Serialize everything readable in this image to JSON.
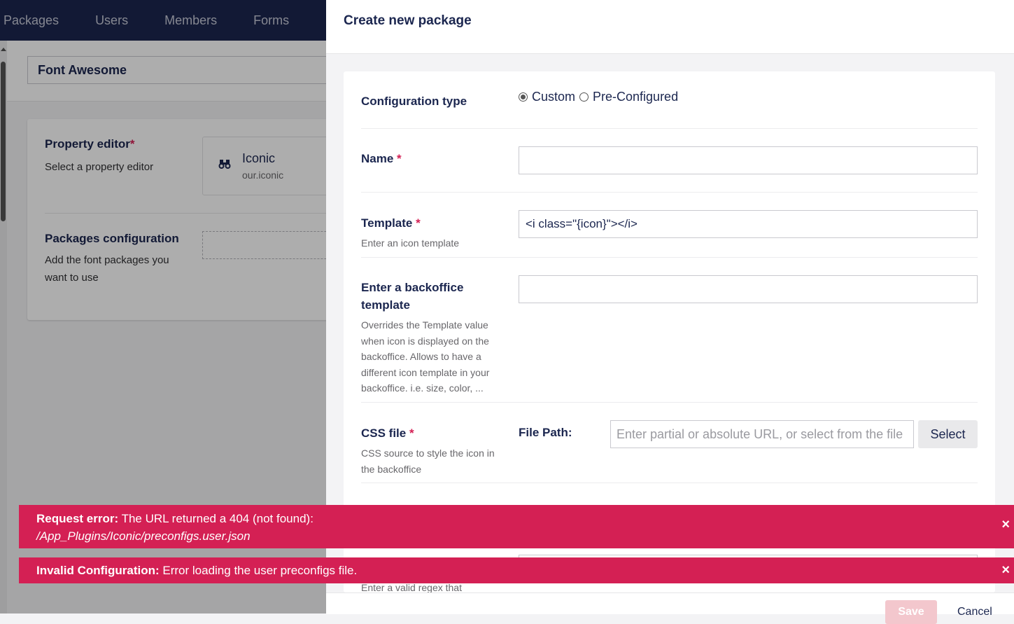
{
  "topnav": {
    "items": [
      "Packages",
      "Users",
      "Members",
      "Forms"
    ]
  },
  "background": {
    "title_value": "Font Awesome",
    "property_editor": {
      "label": "Property editor",
      "required_mark": "*",
      "description": "Select a property editor",
      "editor_name": "Iconic",
      "editor_alias": "our.iconic",
      "icon": "binoculars-icon"
    },
    "packages_configuration": {
      "label": "Packages configuration",
      "description": "Add the font packages you want to use"
    }
  },
  "dialog": {
    "title": "Create new package",
    "configuration_type": {
      "label": "Configuration type",
      "options": [
        {
          "label": "Custom",
          "checked": true
        },
        {
          "label": "Pre-Configured",
          "checked": false
        }
      ]
    },
    "name": {
      "label": "Name",
      "required_mark": "*",
      "value": ""
    },
    "template": {
      "label": "Template",
      "required_mark": "*",
      "description": "Enter an icon template",
      "value": "<i class=\"{icon}\"></i>"
    },
    "backoffice_template": {
      "label": "Enter a backoffice template",
      "description": "Overrides the Template value when icon is displayed on the backoffice. Allows to have a different icon template in your backoffice. i.e. size, color, ...",
      "value": ""
    },
    "css_file": {
      "label": "CSS file",
      "required_mark": "*",
      "description": "CSS source to style the icon in the backoffice",
      "file_path_label": "File Path:",
      "placeholder": "Enter partial or absolute URL, or select from the file",
      "select_label": "Select"
    },
    "regex_hint": "Enter a valid regex that",
    "footer": {
      "save_label": "Save",
      "cancel_label": "Cancel"
    }
  },
  "notifications": [
    {
      "title": "Request error:",
      "message": "The URL returned a 404 (not found):",
      "detail": "/App_Plugins/Iconic/preconfigs.user.json",
      "close": "×"
    },
    {
      "title": "Invalid Configuration:",
      "message": "Error loading the user preconfigs file.",
      "close": "×"
    }
  ],
  "colors": {
    "nav_bg": "#1b264f",
    "error": "#d42054",
    "text": "#1b264f"
  }
}
